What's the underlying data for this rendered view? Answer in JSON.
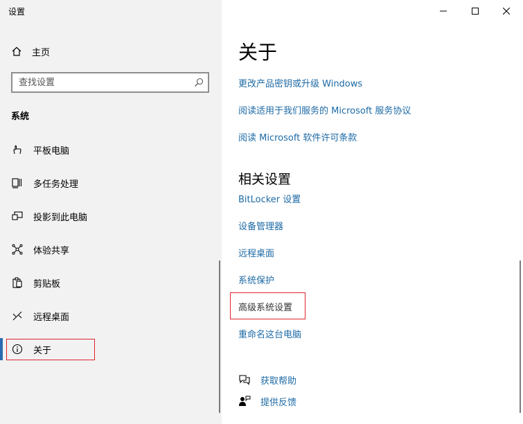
{
  "window": {
    "title": "设置",
    "minimize_icon": "minimize-icon",
    "maximize_icon": "maximize-icon",
    "close_icon": "close-icon"
  },
  "sidebar": {
    "home_label": "主页",
    "search_placeholder": "查找设置",
    "section_title": "系统",
    "items": [
      {
        "label": "平板电脑",
        "icon": "tablet-icon"
      },
      {
        "label": "多任务处理",
        "icon": "multitasking-icon"
      },
      {
        "label": "投影到此电脑",
        "icon": "projecting-icon"
      },
      {
        "label": "体验共享",
        "icon": "shared-experiences-icon"
      },
      {
        "label": "剪贴板",
        "icon": "clipboard-icon"
      },
      {
        "label": "远程桌面",
        "icon": "remote-desktop-icon"
      },
      {
        "label": "关于",
        "icon": "info-icon",
        "selected": true
      }
    ]
  },
  "main": {
    "title": "关于",
    "links": [
      "更改产品密钥或升级 Windows",
      "阅读适用于我们服务的 Microsoft 服务协议",
      "阅读 Microsoft 软件许可条款"
    ],
    "related_title": "相关设置",
    "related_links": [
      "BitLocker 设置",
      "设备管理器",
      "远程桌面",
      "系统保护",
      "高级系统设置",
      "重命名这台电脑"
    ],
    "help": [
      {
        "label": "获取帮助",
        "icon": "help-icon"
      },
      {
        "label": "提供反馈",
        "icon": "feedback-icon"
      }
    ]
  },
  "colors": {
    "link": "#1d6aa5",
    "highlight_box": "#e0242c",
    "selection_bar": "#2b6cb0",
    "sidebar_bg": "#f2f2f2"
  }
}
